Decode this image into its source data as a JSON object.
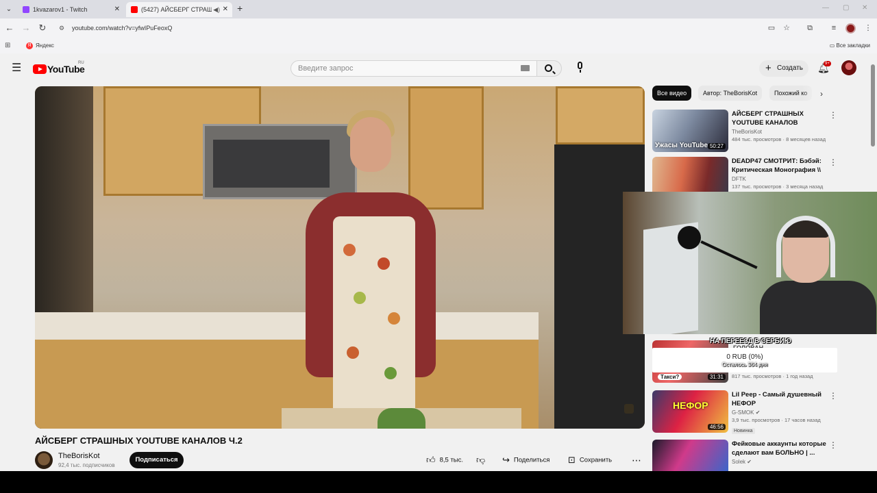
{
  "browser": {
    "tabs": [
      {
        "title": "1kvazarov1 - Twitch",
        "favicon_color": "#9146ff"
      },
      {
        "title": "(5427) АЙСБЕРГ СТРАШНЫХ",
        "favicon_color": "#ff0000"
      }
    ],
    "url": "youtube.com/watch?v=yfwIPuFeoxQ",
    "bookmarks": {
      "yandex": "Яндекс",
      "all": "Все закладки"
    }
  },
  "youtube": {
    "logo_text": "YouTube",
    "region": "RU",
    "search_placeholder": "Введите запрос",
    "create_label": "Создать",
    "notifications_badge": "9+"
  },
  "video": {
    "title": "АЙСБЕРГ СТРАШНЫХ YOUTUBE КАНАЛОВ Ч.2",
    "channel": "TheBorisKot",
    "subscribers": "92,4 тыс. подписчиков",
    "subscribe_label": "Подписаться",
    "likes": "8,5 тыс.",
    "share_label": "Поделиться",
    "save_label": "Сохранить"
  },
  "chips": [
    "Все видео",
    "Автор: TheBorisKot",
    "Похожий ко"
  ],
  "recommendations": [
    {
      "title": "АЙСБЕРГ СТРАШНЫХ YOUTUBE КАНАЛОВ",
      "channel": "TheBorisKot",
      "meta": "484 тыс. просмотров · 8 месяцев назад",
      "duration": "50:27",
      "thumb_text": "Ужасы YouTube",
      "tag": ""
    },
    {
      "title": "DEADP47 СМОТРИТ: Бэбэй: Критическая Монография \\\\ ...",
      "channel": "DFTK",
      "meta": "137 тыс. просмотров · 3 месяца назад",
      "duration": "",
      "thumb_text": "",
      "tag": ""
    },
    {
      "title": "",
      "channel": "",
      "meta": "817 тыс. просмотров · 1 год назад",
      "duration": "31:31",
      "thumb_text": "Такси?",
      "tag": ""
    },
    {
      "title": "Lil Peep - Самый душевный НЕФОР",
      "channel": "G-SMOK",
      "meta": "3,9 тыс. просмотров · 17 часов назад",
      "duration": "46:56",
      "thumb_text": "НЕФОР",
      "tag": "Новинка"
    },
    {
      "title": "Фейковые аккаунты которые сделают вам БОЛЬНО | ...",
      "channel": "Solek",
      "meta": "",
      "duration": "",
      "thumb_text": "",
      "tag": ""
    }
  ],
  "donation": {
    "label": "НА ПЕРЕЕЗД В СЕРБИЮ",
    "amount": "0 RUB (0%)",
    "remaining": "Осталось 364 дня",
    "behind_title": "ГОЛОВАН"
  },
  "colors": {
    "youtube_red": "#ff0000",
    "subscribe_bg": "#0f0f0f",
    "page_bg": "#f1f1f1"
  }
}
